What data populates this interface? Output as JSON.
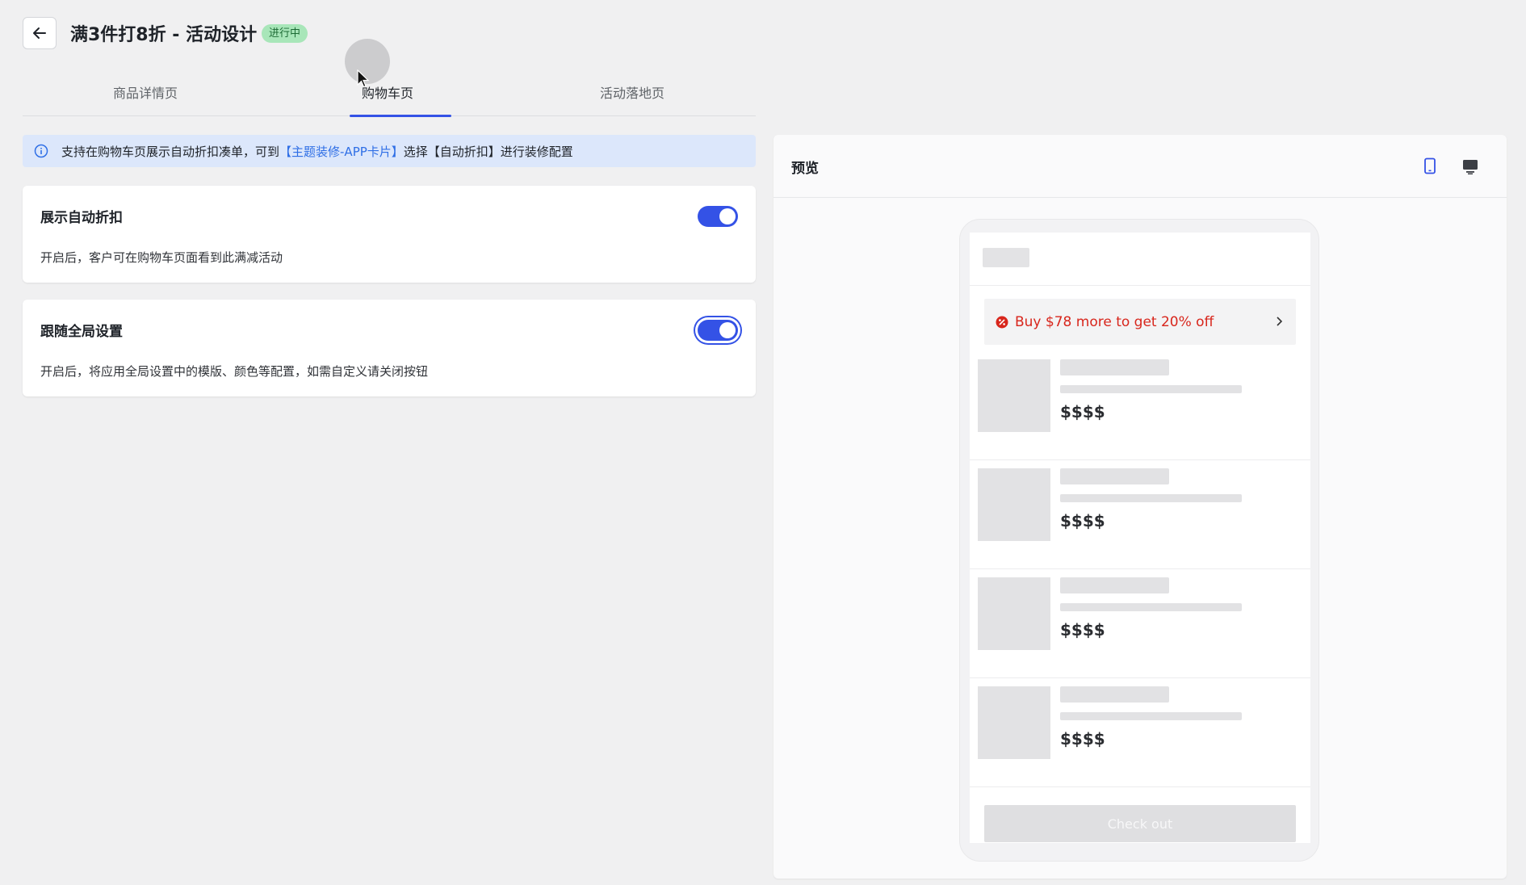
{
  "header": {
    "title": "满3件打8折 - 活动设计",
    "status": "进行中"
  },
  "tabs": [
    {
      "label": "商品详情页"
    },
    {
      "label": "购物车页"
    },
    {
      "label": "活动落地页"
    }
  ],
  "active_tab": "购物车页",
  "banner": {
    "before": "支持在购物车页展示自动折扣凑单，可到",
    "link": "【主题装修-APP卡片】",
    "after": "选择【自动折扣】进行装修配置"
  },
  "settings": [
    {
      "title": "展示自动折扣",
      "desc": "开启后，客户可在购物车页面看到此满减活动",
      "enabled": true
    },
    {
      "title": "跟随全局设置",
      "desc": "开启后，将应用全局设置中的模版、颜色等配置，如需自定义请关闭按钮",
      "enabled": true
    }
  ],
  "preview": {
    "title": "预览",
    "devices": [
      "mobile-icon",
      "desktop-icon"
    ],
    "selected_device": "mobile",
    "promo_text": "Buy $78 more to get 20% off",
    "items": [
      {
        "price": "$$$$"
      },
      {
        "price": "$$$$"
      },
      {
        "price": "$$$$"
      },
      {
        "price": "$$$$"
      }
    ],
    "checkout_label": "Check out"
  },
  "colors": {
    "accent": "#3452e6",
    "promo": "#d8261c",
    "badge_bg": "#a8e6b9",
    "banner_bg": "#dce7fb"
  }
}
